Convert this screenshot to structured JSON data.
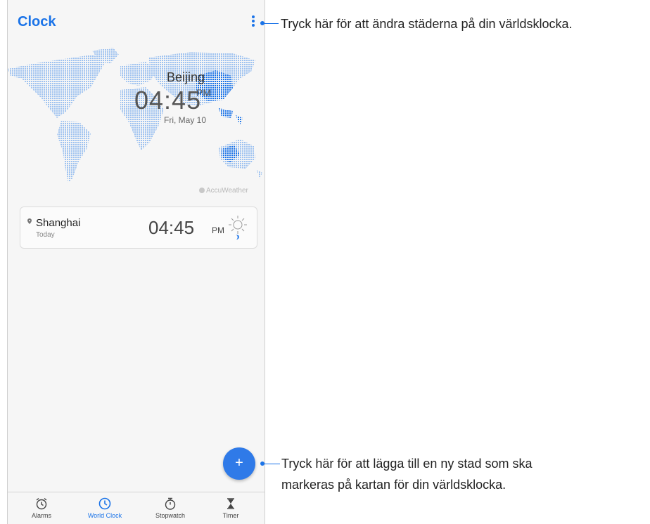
{
  "app": {
    "title": "Clock"
  },
  "map": {
    "city": "Beijing",
    "time": "04:45",
    "ampm": "PM",
    "date": "Fri, May 10",
    "provider": "AccuWeather"
  },
  "cities": [
    {
      "name": "Shanghai",
      "day": "Today",
      "time": "04:45",
      "ampm": "PM",
      "weather_icon": "sun-moon-icon"
    }
  ],
  "fab": {
    "label": "+"
  },
  "nav": [
    {
      "label": "Alarms",
      "icon": "alarm-clock-icon",
      "active": false
    },
    {
      "label": "World Clock",
      "icon": "clock-icon",
      "active": true
    },
    {
      "label": "Stopwatch",
      "icon": "stopwatch-icon",
      "active": false
    },
    {
      "label": "Timer",
      "icon": "hourglass-icon",
      "active": false
    }
  ],
  "callouts": {
    "menu": "Tryck här för att ändra städerna på din världsklocka.",
    "add_line1": "Tryck här för att lägga till en ny stad som ska",
    "add_line2": "markeras på kartan för din världsklocka."
  },
  "colors": {
    "accent": "#1a73e8",
    "fab": "#2f7ae8",
    "map_dots": "#9ec2f0",
    "map_highlight": "#1a73e8"
  }
}
